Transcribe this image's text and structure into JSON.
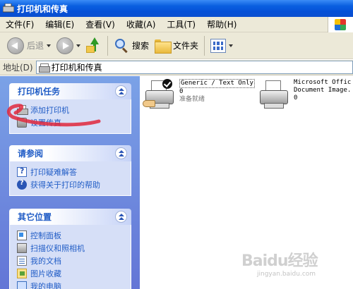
{
  "window": {
    "title": "打印机和传真"
  },
  "menu": {
    "items": [
      "文件(F)",
      "编辑(E)",
      "查看(V)",
      "收藏(A)",
      "工具(T)",
      "帮助(H)"
    ]
  },
  "toolbar": {
    "back": "后退",
    "search": "搜索",
    "folders": "文件夹"
  },
  "address": {
    "label": "地址(D)",
    "value": "打印机和传真"
  },
  "tasks": {
    "printer_tasks": {
      "title": "打印机任务",
      "items": [
        "添加打印机",
        "设置传真"
      ]
    },
    "see_also": {
      "title": "请参阅",
      "items": [
        "打印疑难解答",
        "获得关于打印的帮助"
      ]
    },
    "other_places": {
      "title": "其它位置",
      "items": [
        "控制面板",
        "扫描仪和照相机",
        "我的文档",
        "图片收藏",
        "我的电脑"
      ]
    }
  },
  "printers": [
    {
      "name": "Generic / Text Only",
      "docs": "0",
      "status": "准备就绪",
      "default": true
    },
    {
      "name_line1": "Microsoft Offic",
      "name_line2": "Document Image.",
      "docs": "0"
    }
  ],
  "watermark": {
    "brand": "Baidu经验",
    "url": "jingyan.baidu.com"
  },
  "colors": {
    "titlebar": "#0a5fe0",
    "taskpane": "#6375d6",
    "link": "#215dc6",
    "annotation": "#e0283c"
  }
}
